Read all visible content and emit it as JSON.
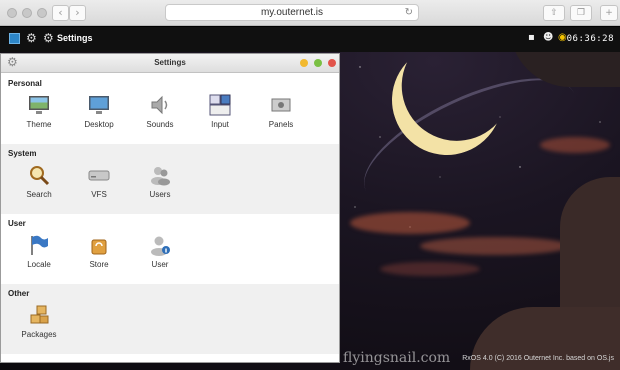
{
  "browser": {
    "url": "my.outernet.is",
    "back_glyph": "‹",
    "forward_glyph": "›",
    "reload_glyph": "↻"
  },
  "panel": {
    "menu_label": "Settings",
    "clock": "06:36:28"
  },
  "window": {
    "title": "Settings"
  },
  "sections": [
    {
      "title": "Personal",
      "items": [
        {
          "label": "Theme",
          "icon": "monitor-landscape-icon"
        },
        {
          "label": "Desktop",
          "icon": "monitor-icon"
        },
        {
          "label": "Sounds",
          "icon": "speaker-icon"
        },
        {
          "label": "Input",
          "icon": "keyboard-keys-icon"
        },
        {
          "label": "Panels",
          "icon": "panels-icon"
        }
      ]
    },
    {
      "title": "System",
      "items": [
        {
          "label": "Search",
          "icon": "magnifier-icon"
        },
        {
          "label": "VFS",
          "icon": "drive-icon"
        },
        {
          "label": "Users",
          "icon": "users-icon"
        }
      ]
    },
    {
      "title": "User",
      "items": [
        {
          "label": "Locale",
          "icon": "flag-icon"
        },
        {
          "label": "Store",
          "icon": "store-icon"
        },
        {
          "label": "User",
          "icon": "user-info-icon"
        }
      ]
    },
    {
      "title": "Other",
      "items": [
        {
          "label": "Packages",
          "icon": "packages-icon"
        }
      ]
    }
  ],
  "watermark": "flyingsnail.com",
  "footer_note": "RxOS 4.0 (C) 2016 Outernet Inc. based on OS.js",
  "colors": {
    "panel_bg": "#101010",
    "window_bg": "#ffffff",
    "section_alt_bg": "#f0f0f0",
    "btn_yellow": "#f2b92f",
    "btn_green": "#7ac043",
    "btn_red": "#e2544b",
    "planet": "#f3e2a6"
  }
}
